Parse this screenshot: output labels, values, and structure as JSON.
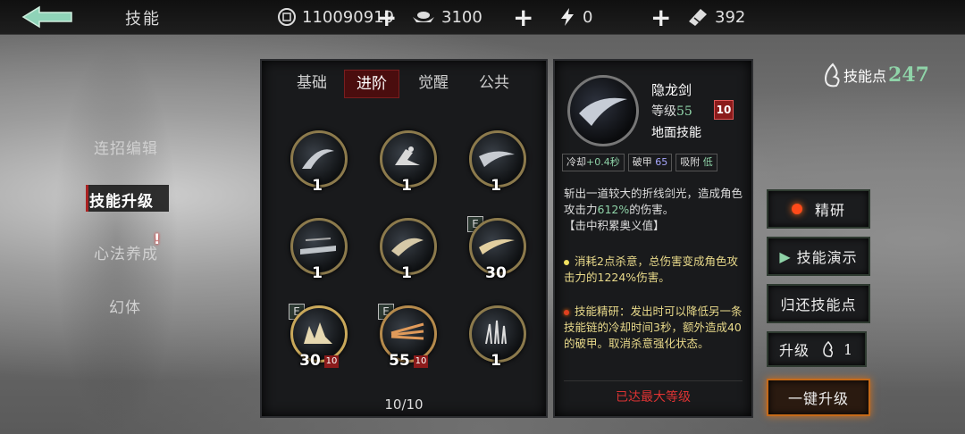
{
  "topbar": {
    "title": "技能",
    "currencies": [
      {
        "icon": "coin-icon",
        "value": "110090919"
      },
      {
        "icon": "silver-ingot-icon",
        "value": "3100"
      },
      {
        "icon": "lightning-icon",
        "value": "0"
      },
      {
        "icon": "ticket-icon",
        "value": "392"
      }
    ]
  },
  "sidebar": {
    "items": [
      {
        "label": "连招编辑"
      },
      {
        "label": "技能升级"
      },
      {
        "label": "心法养成"
      },
      {
        "label": "幻体"
      }
    ],
    "alert": "!"
  },
  "tabs": [
    "基础",
    "进阶",
    "觉醒",
    "公共"
  ],
  "skills": [
    {
      "level": "1",
      "e": false,
      "badge": ""
    },
    {
      "level": "1",
      "e": false,
      "badge": ""
    },
    {
      "level": "1",
      "e": false,
      "badge": ""
    },
    {
      "level": "1",
      "e": false,
      "badge": ""
    },
    {
      "level": "1",
      "e": false,
      "badge": ""
    },
    {
      "level": "30",
      "e": true,
      "badge": ""
    },
    {
      "level": "30",
      "e": true,
      "badge": "10"
    },
    {
      "level": "55",
      "e": true,
      "badge": "10"
    },
    {
      "level": "1",
      "e": false,
      "badge": ""
    }
  ],
  "e_label": "E",
  "pages": "10/10",
  "detail": {
    "name": "隐龙剑",
    "level_label": "等级",
    "level_value": "55",
    "rank_badge": "10",
    "type": "地面技能",
    "stats": [
      {
        "label": "冷却",
        "value": "+0.4秒"
      },
      {
        "label": "破甲",
        "value": "65"
      },
      {
        "label": "吸附",
        "value": "低"
      }
    ],
    "desc_1": "斩出一道较大的折线剑光，造成角色攻击力",
    "desc_pct": "612%",
    "desc_2": "的伤害。",
    "desc_3": "【击中积累奥义值】",
    "note1": "消耗2点杀意，总伤害变成角色攻击力的1224%伤害。",
    "note2": "技能精研：发出时可以降低另一条技能链的冷却时间3秒，额外造成40的破甲。取消杀意强化状态。",
    "max_level": "已达最大等级"
  },
  "skill_points": {
    "label": "技能点",
    "value": "247"
  },
  "buttons": {
    "refine": "精研",
    "demo": "技能演示",
    "refund": "归还技能点",
    "upgrade": "升级",
    "upgrade_count": "1",
    "one_click": "一键升级"
  },
  "colors": {
    "accent_green": "#8fd3a8",
    "accent_red": "#8b1b1b",
    "gold_border": "#8c7a4c"
  }
}
